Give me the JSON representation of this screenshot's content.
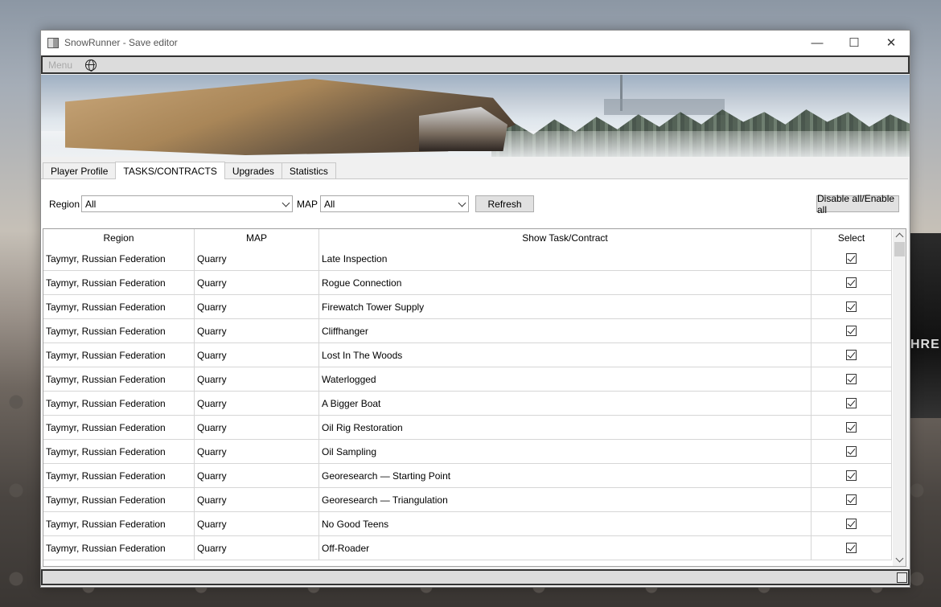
{
  "window": {
    "title": "SnowRunner - Save editor",
    "controls": {
      "minimize": "—",
      "maximize": "☐",
      "close": "✕"
    }
  },
  "menubar": {
    "menu_label": "Menu"
  },
  "tabs": [
    {
      "label": "Player Profile",
      "active": false
    },
    {
      "label": "TASKS/CONTRACTS",
      "active": true
    },
    {
      "label": "Upgrades",
      "active": false
    },
    {
      "label": "Statistics",
      "active": false
    }
  ],
  "filters": {
    "region_label": "Region",
    "region_value": "All",
    "map_label": "MAP",
    "map_value": "All",
    "refresh_label": "Refresh",
    "toggle_all_label": "Disable all/Enable all"
  },
  "table": {
    "columns": [
      "Region",
      "MAP",
      "Show Task/Contract",
      "Select"
    ],
    "rows": [
      {
        "region": "Taymyr, Russian Federation",
        "map": "Quarry",
        "task": "Late Inspection",
        "selected": true
      },
      {
        "region": "Taymyr, Russian Federation",
        "map": "Quarry",
        "task": "Rogue Connection",
        "selected": true
      },
      {
        "region": "Taymyr, Russian Federation",
        "map": "Quarry",
        "task": "Firewatch Tower Supply",
        "selected": true
      },
      {
        "region": "Taymyr, Russian Federation",
        "map": "Quarry",
        "task": "Cliffhanger",
        "selected": true
      },
      {
        "region": "Taymyr, Russian Federation",
        "map": "Quarry",
        "task": "Lost In The Woods",
        "selected": true
      },
      {
        "region": "Taymyr, Russian Federation",
        "map": "Quarry",
        "task": "Waterlogged",
        "selected": true
      },
      {
        "region": "Taymyr, Russian Federation",
        "map": "Quarry",
        "task": "A Bigger Boat",
        "selected": true
      },
      {
        "region": "Taymyr, Russian Federation",
        "map": "Quarry",
        "task": "Oil Rig Restoration",
        "selected": true
      },
      {
        "region": "Taymyr, Russian Federation",
        "map": "Quarry",
        "task": "Oil Sampling",
        "selected": true
      },
      {
        "region": "Taymyr, Russian Federation",
        "map": "Quarry",
        "task": "Georesearch — Starting Point",
        "selected": true
      },
      {
        "region": "Taymyr, Russian Federation",
        "map": "Quarry",
        "task": "Georesearch — Triangulation",
        "selected": true
      },
      {
        "region": "Taymyr, Russian Federation",
        "map": "Quarry",
        "task": "No Good Teens",
        "selected": true
      },
      {
        "region": "Taymyr, Russian Federation",
        "map": "Quarry",
        "task": "Off-Roader",
        "selected": true
      }
    ]
  },
  "background": {
    "car_badge": "HRE"
  }
}
